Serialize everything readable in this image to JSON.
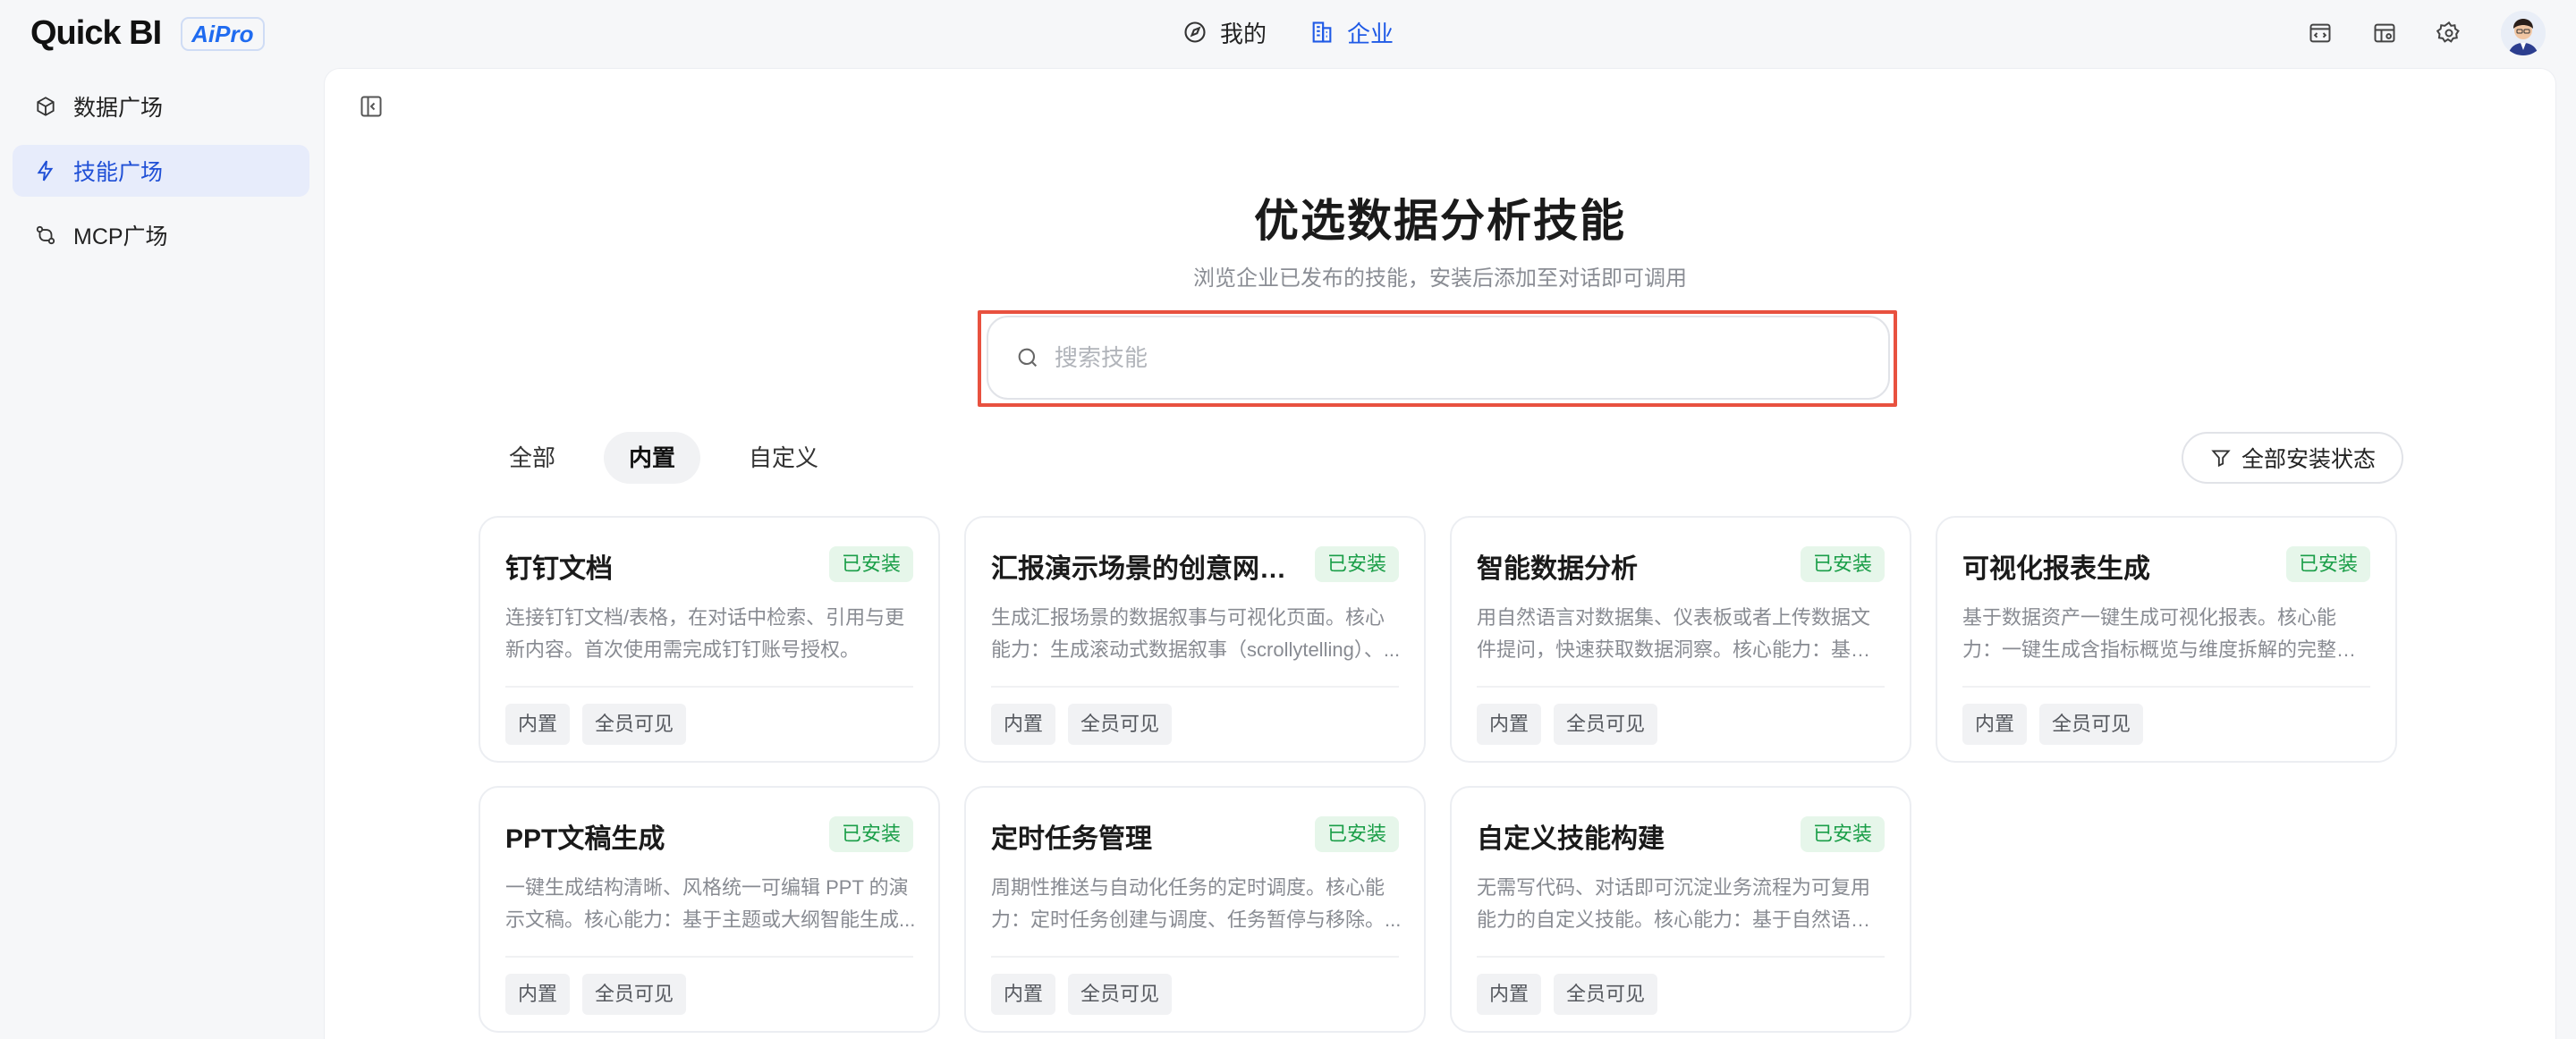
{
  "app": {
    "logo_text": "Quick BI",
    "logo_badge": "AiPro"
  },
  "topnav": {
    "items": [
      {
        "label": "我的",
        "icon": "compass-icon",
        "active": false
      },
      {
        "label": "企业",
        "icon": "building-icon",
        "active": true
      }
    ]
  },
  "topright": {
    "icons": [
      "code-window-icon",
      "table-settings-icon",
      "gear-icon",
      "avatar"
    ]
  },
  "sidebar": {
    "items": [
      {
        "label": "数据广场",
        "icon": "cube-icon",
        "active": false
      },
      {
        "label": "技能广场",
        "icon": "lightning-icon",
        "active": true
      },
      {
        "label": "MCP广场",
        "icon": "link-nodes-icon",
        "active": false
      }
    ]
  },
  "hero": {
    "title": "优选数据分析技能",
    "subtitle": "浏览企业已发布的技能，安装后添加至对话即可调用"
  },
  "search": {
    "placeholder": "搜索技能",
    "value": ""
  },
  "tabs": [
    {
      "label": "全部",
      "active": false
    },
    {
      "label": "内置",
      "active": true
    },
    {
      "label": "自定义",
      "active": false
    }
  ],
  "filter": {
    "label": "全部安装状态"
  },
  "colors": {
    "accent": "#1f5ae6",
    "installed_green": "#1a9e48",
    "highlight_red": "#e8513f"
  },
  "cards": [
    {
      "title": "钉钉文档",
      "status": "已安装",
      "desc": "连接钉钉文档/表格，在对话中检索、引用与更新内容。首次使用需完成钉钉账号授权。",
      "tags": [
        "内置",
        "全员可见"
      ]
    },
    {
      "title": "汇报演示场景的创意网页...",
      "status": "已安装",
      "desc": "生成汇报场景的数据叙事与可视化页面。核心能力：生成滚动式数据叙事（scrollytelling）、...",
      "tags": [
        "内置",
        "全员可见"
      ]
    },
    {
      "title": "智能数据分析",
      "status": "已安装",
      "desc": "用自然语言对数据集、仪表板或者上传数据文件提问，快速获取数据洞察。核心能力：基于数...",
      "tags": [
        "内置",
        "全员可见"
      ]
    },
    {
      "title": "可视化报表生成",
      "status": "已安装",
      "desc": "基于数据资产一键生成可视化报表。核心能力：一键生成含指标概览与维度拆解的完整报表。...",
      "tags": [
        "内置",
        "全员可见"
      ]
    },
    {
      "title": "PPT文稿生成",
      "status": "已安装",
      "desc": "一键生成结构清晰、风格统一可编辑 PPT 的演示文稿。核心能力：基于主题或大纲智能生成...",
      "tags": [
        "内置",
        "全员可见"
      ]
    },
    {
      "title": "定时任务管理",
      "status": "已安装",
      "desc": "周期性推送与自动化任务的定时调度。核心能力：定时任务创建与调度、任务暂停与移除。...",
      "tags": [
        "内置",
        "全员可见"
      ]
    },
    {
      "title": "自定义技能构建",
      "status": "已安装",
      "desc": "无需写代码、对话即可沉淀业务流程为可复用能力的自定义技能。核心能力：基于自然语言对...",
      "tags": [
        "内置",
        "全员可见"
      ]
    }
  ]
}
